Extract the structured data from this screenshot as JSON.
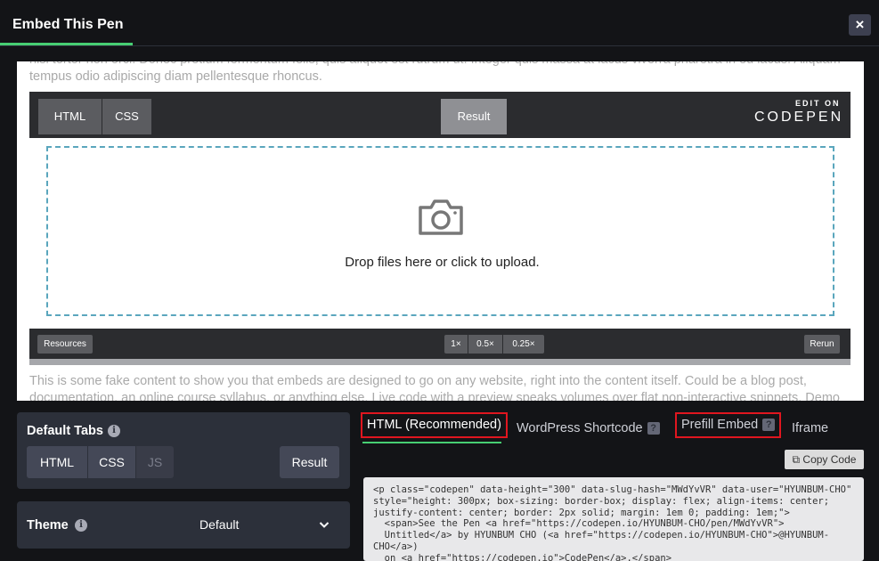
{
  "header": {
    "title": "Embed This Pen",
    "close_label": "×"
  },
  "preview": {
    "fake_text_top": "nisl tortor non orci. Donec pretium fermentum felis, quis aliquet est rutrum ut. Integer quis massa at lacus viverra pharetra in eu lacus. Aliquam tempus odio adipiscing diam pellentesque rhoncus.",
    "fake_text_bottom": "This is some fake content to show you that embeds are designed to go on any website, right into the content itself. Could be a blog post, documentation, an online course syllabus, or anything else. Live code with a preview speaks volumes over flat non-interactive snippets. Demo",
    "tabs": {
      "html": "HTML",
      "css": "CSS",
      "result": "Result"
    },
    "edit_on": "EDIT ON",
    "brand": "CODEPEN",
    "drop_text": "Drop files here or click to upload.",
    "footer": {
      "resources": "Resources",
      "zoom1": "1×",
      "zoom2": "0.5×",
      "zoom3": "0.25×",
      "rerun": "Rerun"
    }
  },
  "default_tabs": {
    "label": "Default Tabs",
    "info": "i",
    "options": {
      "html": "HTML",
      "css": "CSS",
      "js": "JS",
      "result": "Result"
    }
  },
  "theme": {
    "label": "Theme",
    "info": "i",
    "value": "Default"
  },
  "code_tabs": {
    "html": "HTML (Recommended)",
    "wordpress": "WordPress Shortcode",
    "prefill": "Prefill Embed",
    "iframe": "Iframe",
    "help": "?"
  },
  "copy_label": "Copy Code",
  "code": "<p class=\"codepen\" data-height=\"300\" data-slug-hash=\"MWdYvVR\" data-user=\"HYUNBUM-CHO\"\nstyle=\"height: 300px; box-sizing: border-box; display: flex; align-items: center;\njustify-content: center; border: 2px solid; margin: 1em 0; padding: 1em;\">\n  <span>See the Pen <a href=\"https://codepen.io/HYUNBUM-CHO/pen/MWdYvVR\">\n  Untitled</a> by HYUNBUM CHO (<a href=\"https://codepen.io/HYUNBUM-CHO\">@HYUNBUM-\nCHO</a>)\n  on <a href=\"https://codepen.io\">CodePen</a>.</span>",
  "colors": {
    "accent": "#47cf73",
    "highlight": "#e0161f",
    "panel": "#2c303a",
    "background": "#131417"
  }
}
